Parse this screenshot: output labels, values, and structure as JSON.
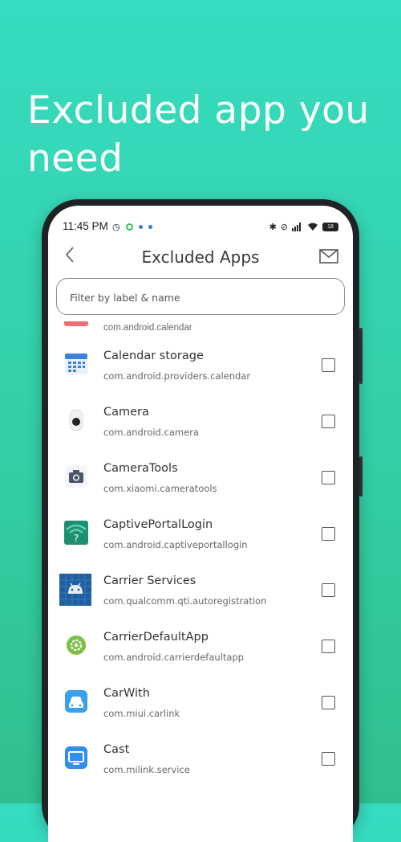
{
  "headline": "Excluded app you need",
  "status_bar": {
    "time": "11:45 PM",
    "battery": "18"
  },
  "header": {
    "title": "Excluded Apps"
  },
  "filter": {
    "placeholder": "Filter by label & name"
  },
  "partial_row": {
    "package": "com.android.calendar"
  },
  "apps": [
    {
      "label": "Calendar storage",
      "package": "com.android.providers.calendar",
      "icon": "calendar-storage-icon",
      "checked": false
    },
    {
      "label": "Camera",
      "package": "com.android.camera",
      "icon": "camera-icon",
      "checked": false
    },
    {
      "label": "CameraTools",
      "package": "com.xiaomi.cameratools",
      "icon": "cameratools-icon",
      "checked": false
    },
    {
      "label": "CaptivePortalLogin",
      "package": "com.android.captiveportallogin",
      "icon": "captive-portal-icon",
      "checked": false
    },
    {
      "label": "Carrier Services",
      "package": "com.qualcomm.qti.autoregistration",
      "icon": "android-robot-icon",
      "checked": false
    },
    {
      "label": "CarrierDefaultApp",
      "package": "com.android.carrierdefaultapp",
      "icon": "gear-icon",
      "checked": false
    },
    {
      "label": "CarWith",
      "package": "com.miui.carlink",
      "icon": "car-icon",
      "checked": false
    },
    {
      "label": "Cast",
      "package": "com.milink.service",
      "icon": "cast-icon",
      "checked": false
    }
  ],
  "colors": {
    "background_top": "#36dcc0",
    "background_bottom": "#2fbf8e",
    "phone_frame": "#1f2326"
  }
}
